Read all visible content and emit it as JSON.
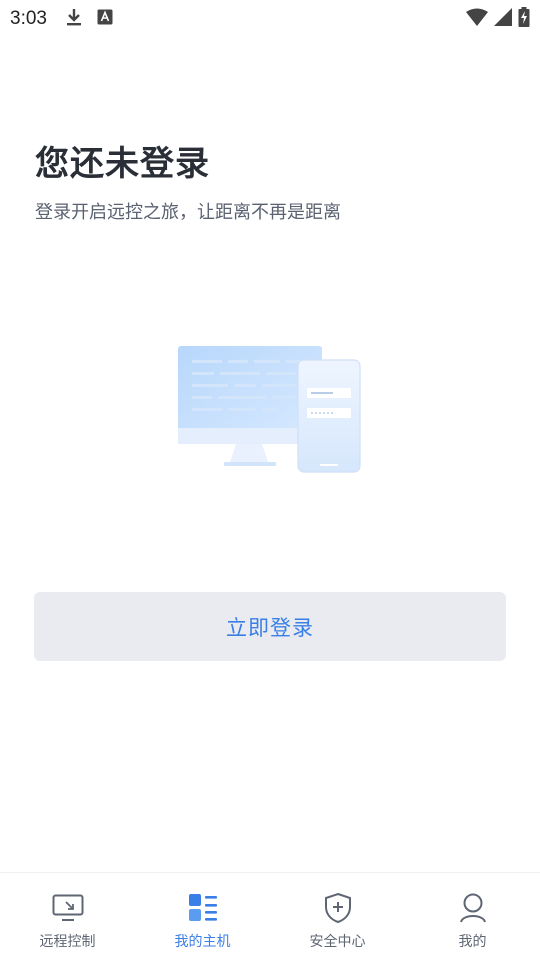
{
  "status_bar": {
    "time": "3:03",
    "icons": [
      "download-icon",
      "keyboard-a-icon",
      "wifi-icon",
      "signal-icon",
      "battery-charging-icon"
    ]
  },
  "login_prompt": {
    "title": "您还未登录",
    "subtitle": "登录开启远控之旅，让距离不再是距离",
    "button_label": "立即登录"
  },
  "bottom_nav": {
    "items": [
      {
        "label": "远程控制",
        "icon": "remote-desktop-icon",
        "active": false
      },
      {
        "label": "我的主机",
        "icon": "host-list-icon",
        "active": true
      },
      {
        "label": "安全中心",
        "icon": "shield-plus-icon",
        "active": false
      },
      {
        "label": "我的",
        "icon": "user-icon",
        "active": false
      }
    ]
  },
  "colors": {
    "accent": "#3a7fe6",
    "button_bg": "#e9ebf0",
    "title": "#2a2e36",
    "subtitle": "#5a6170",
    "nav_text": "#5f6673"
  }
}
